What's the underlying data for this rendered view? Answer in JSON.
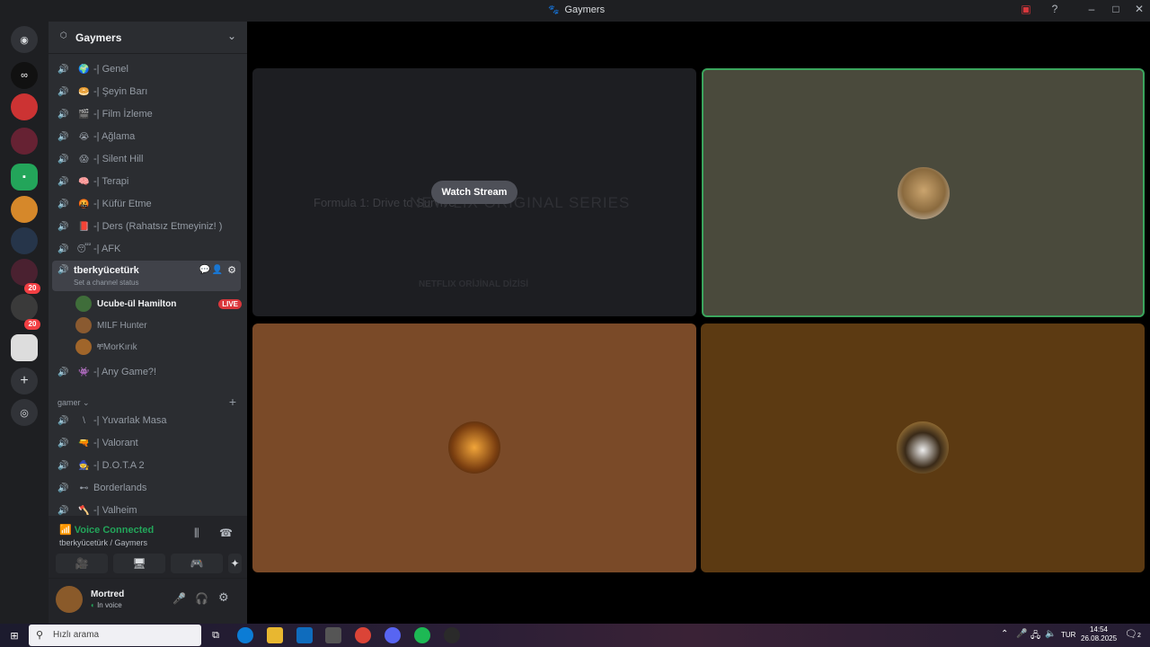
{
  "window": {
    "title": "Gaymers",
    "controls": [
      "minimize",
      "maximize",
      "close"
    ]
  },
  "server": {
    "name": "Gaymers"
  },
  "channels_top": [
    {
      "emoji": "🌍",
      "label": "-| Genel"
    },
    {
      "emoji": "🥯",
      "label": "-| Şeyin Barı"
    },
    {
      "emoji": "🎬",
      "label": "-| Film İzleme"
    },
    {
      "emoji": "😭",
      "label": "-| Ağlama"
    },
    {
      "emoji": "😱",
      "label": "-| Silent Hill"
    },
    {
      "emoji": "🧠",
      "label": "-| Terapi"
    },
    {
      "emoji": "🤬",
      "label": "-| Küfür Etme"
    },
    {
      "emoji": "📕",
      "label": "-| Ders (Rahatsız Etmeyiniz! )"
    },
    {
      "emoji": "😴",
      "label": "-| AFK"
    }
  ],
  "active_channel": {
    "label": "tberkyücetürk",
    "status": "Set a channel status"
  },
  "voice_users": [
    {
      "name": "Ucube-ül Hamilton",
      "live": "LIVE"
    },
    {
      "name": "MILF Hunter"
    },
    {
      "name": "ቸMorKırık"
    }
  ],
  "channel_after": {
    "emoji": "👾",
    "label": "-| Any Game?!"
  },
  "category": {
    "label": "gamer"
  },
  "channels_gamer": [
    {
      "emoji": "\\",
      "label": "-| Yuvarlak Masa"
    },
    {
      "emoji": "🔫",
      "label": "-| Valorant"
    },
    {
      "emoji": "🧙",
      "label": "-| D.O.T.A 2"
    },
    {
      "emoji": "⊷",
      "label": "Borderlands"
    },
    {
      "emoji": "🪓",
      "label": "-| Valheim"
    }
  ],
  "voice_panel": {
    "status": "Voice Connected",
    "location": "tberkyücetürk / Gaymers"
  },
  "user_panel": {
    "name": "Mortred",
    "status": "In voice"
  },
  "server_badges": [
    "20",
    "20"
  ],
  "stream": {
    "button": "Watch Stream",
    "preview_title": "Formula 1: Drive to Survive",
    "preview_tag": "NETFLIX ORIGINAL SERIES",
    "preview_sub": "NETFLIX ORİJİNAL DİZİSİ"
  },
  "colors": {
    "tile_top_right": "#4a4a3c",
    "tile_bottom_left": "#7a4a28",
    "tile_bottom_right": "#5c3a12",
    "speaking_border": "#3ba55d",
    "live_red": "#da373c",
    "connected_green": "#23a55a"
  },
  "taskbar": {
    "search_placeholder": "Hızlı arama",
    "lang": "TUR",
    "time": "14:54",
    "date": "26.08.2025",
    "notif": "2"
  }
}
